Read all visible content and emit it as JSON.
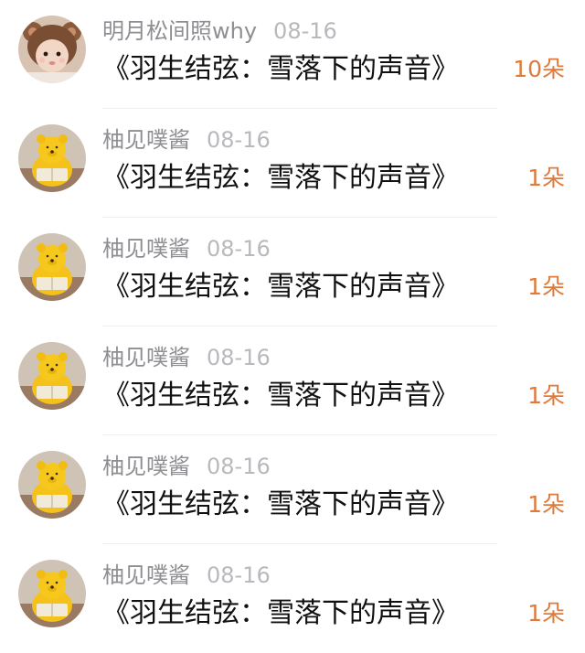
{
  "gift_list": {
    "items": [
      {
        "username": "明月松间照why",
        "date": "08-16",
        "title": "《羽生结弦：雪落下的声音》",
        "amount": "10朵",
        "avatar_icon": "baby-in-bear-hat-avatar"
      },
      {
        "username": "柚见噗酱",
        "date": "08-16",
        "title": "《羽生结弦：雪落下的声音》",
        "amount": "1朵",
        "avatar_icon": "winnie-the-pooh-avatar"
      },
      {
        "username": "柚见噗酱",
        "date": "08-16",
        "title": "《羽生结弦：雪落下的声音》",
        "amount": "1朵",
        "avatar_icon": "winnie-the-pooh-avatar"
      },
      {
        "username": "柚见噗酱",
        "date": "08-16",
        "title": "《羽生结弦：雪落下的声音》",
        "amount": "1朵",
        "avatar_icon": "winnie-the-pooh-avatar"
      },
      {
        "username": "柚见噗酱",
        "date": "08-16",
        "title": "《羽生结弦：雪落下的声音》",
        "amount": "1朵",
        "avatar_icon": "winnie-the-pooh-avatar"
      },
      {
        "username": "柚见噗酱",
        "date": "08-16",
        "title": "《羽生结弦：雪落下的声音》",
        "amount": "1朵",
        "avatar_icon": "winnie-the-pooh-avatar"
      }
    ]
  },
  "colors": {
    "username": "#8e8e93",
    "date": "#b9b9bd",
    "title": "#111111",
    "amount": "#e07a3a",
    "divider": "#efefef"
  }
}
